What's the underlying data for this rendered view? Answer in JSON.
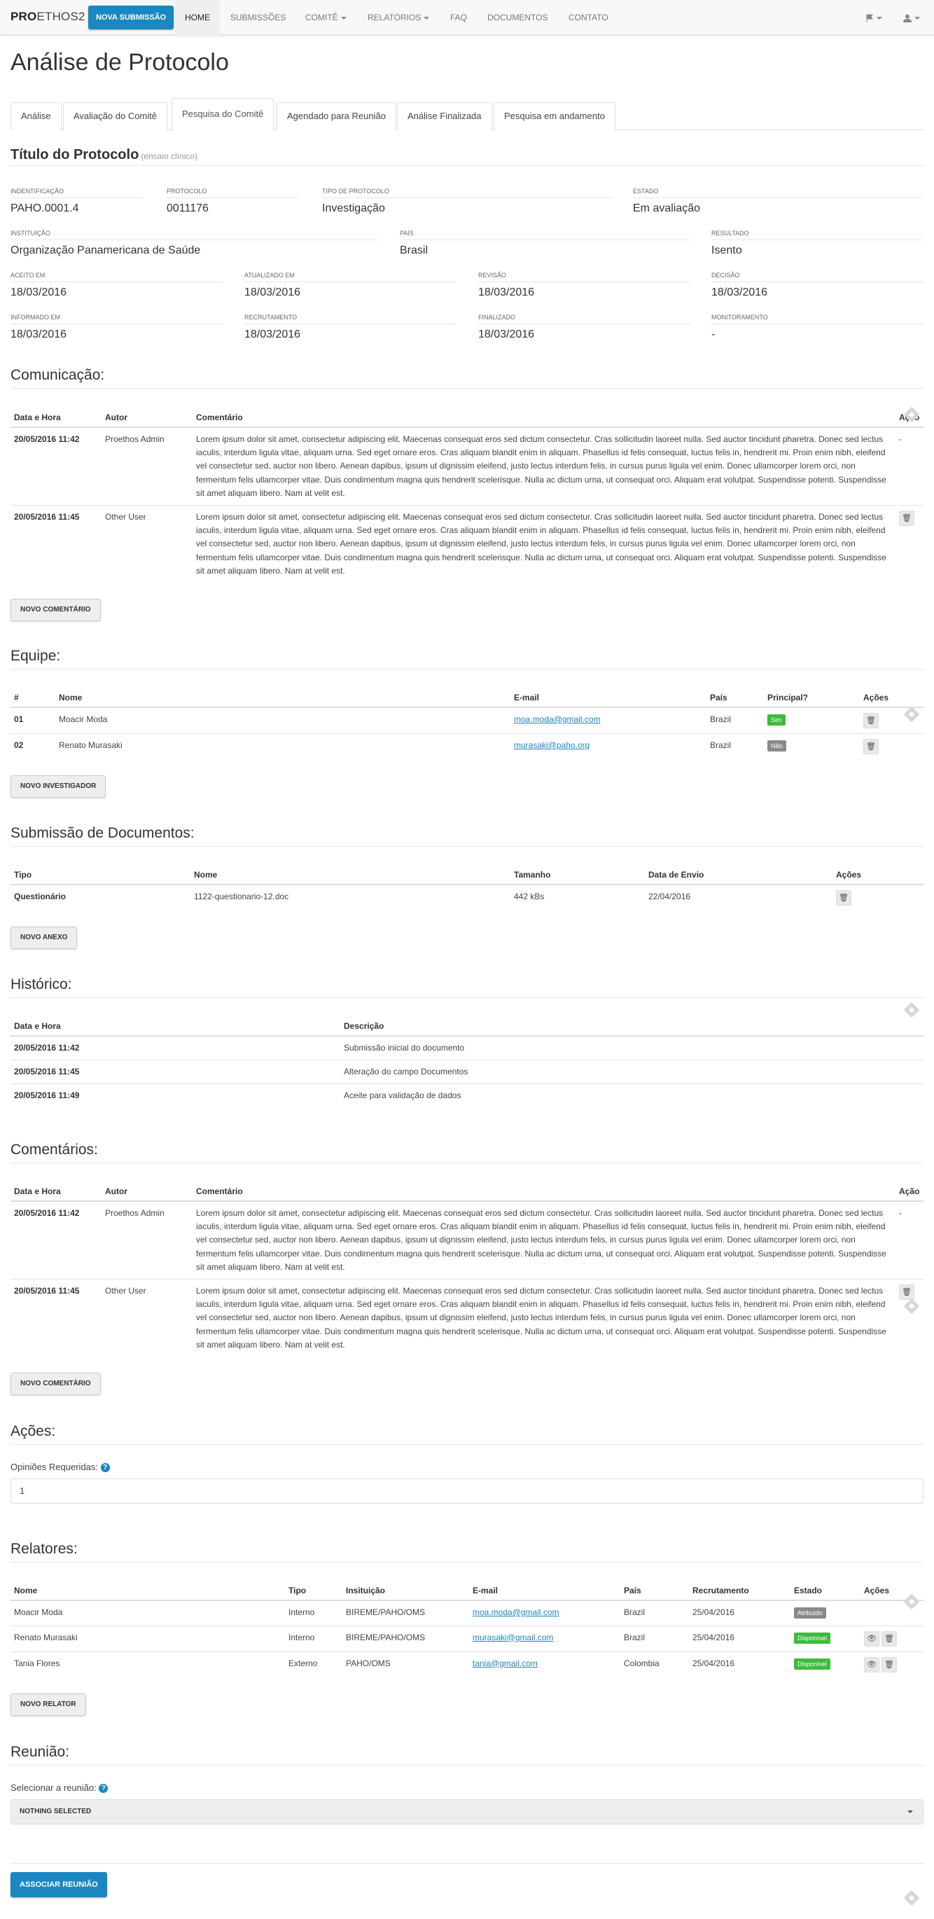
{
  "nav": {
    "brand_bold": "PRO",
    "brand_light": "ETHOS2",
    "new_submission": "Nova Submissão",
    "items": [
      "Home",
      "Submissões",
      "Comitê",
      "Relatórios",
      "FAQ",
      "Documentos",
      "Contato"
    ],
    "flag_icon": "flag-icon",
    "user_icon": "user-icon"
  },
  "page_title": "Análise de Protocolo",
  "tabs": [
    "Análise",
    "Avaliação do Comitê",
    "Pesquisa do Comitê",
    "Agendado para Reunião",
    "Análise Finalizada",
    "Pesquisa em andamento"
  ],
  "protocol": {
    "title": "Título do Protocolo",
    "subtitle": "(ensaio clínico)",
    "fields": [
      {
        "label": "Indentificação",
        "value": "PAHO.0001.4"
      },
      {
        "label": "Protocolo",
        "value": "0011176"
      },
      {
        "label": "Tipo de Protocolo",
        "value": "Investigação"
      },
      {
        "label": "Estado",
        "value": "Em avaliação"
      },
      {
        "label": "Instituição",
        "value": "Organização Panamericana de Saúde"
      },
      {
        "label": "País",
        "value": "Brasil"
      },
      {
        "label": "Resultado",
        "value": "Isento"
      },
      {
        "label": "Aceito em",
        "value": "18/03/2016"
      },
      {
        "label": "Atualizado em",
        "value": "18/03/2016"
      },
      {
        "label": "Revisão",
        "value": "18/03/2016"
      },
      {
        "label": "Decisão",
        "value": "18/03/2016"
      },
      {
        "label": "Informado em",
        "value": "18/03/2016"
      },
      {
        "label": "Recrutamento",
        "value": "18/03/2016"
      },
      {
        "label": "Finalizado",
        "value": "18/03/2016"
      },
      {
        "label": "Monitoramento",
        "value": "-"
      }
    ]
  },
  "comunicacao": {
    "title": "Comunicação:",
    "headers": [
      "Data e Hora",
      "Autor",
      "Comentário",
      "Ação"
    ],
    "rows": [
      {
        "date": "20/05/2016 11:42",
        "author": "Proethos Admin",
        "comment": "Lorem ipsum dolor sit amet, consectetur adipiscing elit. Maecenas consequat eros sed dictum consectetur. Cras sollicitudin laoreet nulla. Sed auctor tincidunt pharetra. Donec sed lectus iaculis, interdum ligula vitae, aliquam urna. Sed eget ornare eros. Cras aliquam blandit enim in aliquam. Phasellus id felis consequat, luctus felis in, hendrerit mi. Proin enim nibh, eleifend vel consectetur sed, auctor non libero. Aenean dapibus, ipsum ut dignissim eleifend, justo lectus interdum felis, in cursus purus ligula vel enim. Donec ullamcorper lorem orci, non fermentum felis ullamcorper vitae. Duis condimentum magna quis hendrerit scelerisque. Nulla ac dictum urna, ut consequat orci. Aliquam erat volutpat. Suspendisse potenti. Suspendisse sit amet aliquam libero. Nam at velit est.",
        "action": "-"
      },
      {
        "date": "20/05/2016 11:45",
        "author": "Other User",
        "comment": "Lorem ipsum dolor sit amet, consectetur adipiscing elit. Maecenas consequat eros sed dictum consectetur. Cras sollicitudin laoreet nulla. Sed auctor tincidunt pharetra. Donec sed lectus iaculis, interdum ligula vitae, aliquam urna. Sed eget ornare eros. Cras aliquam blandit enim in aliquam. Phasellus id felis consequat, luctus felis in, hendrerit mi. Proin enim nibh, eleifend vel consectetur sed, auctor non libero. Aenean dapibus, ipsum ut dignissim eleifend, justo lectus interdum felis, in cursus purus ligula vel enim. Donec ullamcorper lorem orci, non fermentum felis ullamcorper vitae. Duis condimentum magna quis hendrerit scelerisque. Nulla ac dictum urna, ut consequat orci. Aliquam erat volutpat. Suspendisse potenti. Suspendisse sit amet aliquam libero. Nam at velit est.",
        "action": "trash-icon"
      }
    ],
    "button": "Novo Comentário"
  },
  "equipe": {
    "title": "Equipe:",
    "headers": [
      "#",
      "Nome",
      "E-mail",
      "País",
      "Principal?",
      "Ações"
    ],
    "rows": [
      {
        "num": "01",
        "name": "Moacir Moda",
        "email": "moa.moda@gmail.com",
        "country": "Brazil",
        "principal": "Sim"
      },
      {
        "num": "02",
        "name": "Renato Murasaki",
        "email": "murasaki@paho.org",
        "country": "Brazil",
        "principal": "Não"
      }
    ],
    "button": "Novo Investigador"
  },
  "documentos": {
    "title": "Submissão de Documentos:",
    "headers": [
      "Tipo",
      "Nome",
      "Tamanho",
      "Data de Envio",
      "Ações"
    ],
    "rows": [
      {
        "type": "Questionário",
        "name": "1122-questionario-12.doc",
        "size": "442 kBs",
        "date": "22/04/2016"
      }
    ],
    "button": "Novo Anexo"
  },
  "historico": {
    "title": "Histórico:",
    "headers": [
      "Data e Hora",
      "Descrição"
    ],
    "rows": [
      {
        "date": "20/05/2016 11:42",
        "desc": "Submissão inicial do documento"
      },
      {
        "date": "20/05/2016 11:45",
        "desc": "Alteração do campo Documentos"
      },
      {
        "date": "20/05/2016 11:49",
        "desc": "Aceite para validação de dados"
      }
    ]
  },
  "comentarios": {
    "title": "Comentários:",
    "button": "Novo Comentário"
  },
  "acoes": {
    "title": "Ações:",
    "label": "Opiniões Requeridas:",
    "value": "1"
  },
  "relatores": {
    "title": "Relatores:",
    "headers": [
      "Nome",
      "Tipo",
      "Insituição",
      "E-mail",
      "País",
      "Recrutamento",
      "Estado",
      "Ações"
    ],
    "rows": [
      {
        "name": "Moacir Moda",
        "type": "Interno",
        "inst": "BIREME/PAHO/OMS",
        "email": "moa.moda@gmail.com",
        "country": "Brazil",
        "date": "25/04/2016",
        "state": "Atribuido",
        "state_color": "#8a8a8a",
        "actions": false
      },
      {
        "name": "Renato Murasaki",
        "type": "Interno",
        "inst": "BIREME/PAHO/OMS",
        "email": "murasaki@gmail.com",
        "country": "Brazil",
        "date": "25/04/2016",
        "state": "Disponível",
        "state_color": "#3dbb3d",
        "actions": true
      },
      {
        "name": "Tania Flores",
        "type": "Externo",
        "inst": "PAHO/OMS",
        "email": "tania@gmail.com",
        "country": "Colombia",
        "date": "25/04/2016",
        "state": "Disponível",
        "state_color": "#3dbb3d",
        "actions": true
      }
    ],
    "button": "Novo Relator"
  },
  "reuniao": {
    "title": "Reunião:",
    "label": "Selecionar a reunião:",
    "select": "Nothing selected",
    "button": "Associar Reunião"
  }
}
